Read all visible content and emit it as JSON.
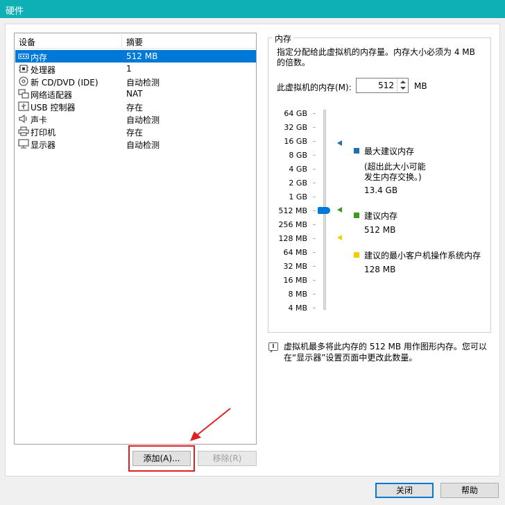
{
  "window": {
    "title": "硬件"
  },
  "device_list": {
    "headers": {
      "device": "设备",
      "summary": "摘要"
    },
    "items": [
      {
        "name": "内存",
        "summary": "512 MB",
        "icon": "memory-icon",
        "selected": true
      },
      {
        "name": "处理器",
        "summary": "1",
        "icon": "processor-icon",
        "selected": false
      },
      {
        "name": "新 CD/DVD (IDE)",
        "summary": "自动检测",
        "icon": "cd-dvd-icon",
        "selected": false
      },
      {
        "name": "网络适配器",
        "summary": "NAT",
        "icon": "network-adapter-icon",
        "selected": false
      },
      {
        "name": "USB 控制器",
        "summary": "存在",
        "icon": "usb-icon",
        "selected": false
      },
      {
        "name": "声卡",
        "summary": "自动检测",
        "icon": "sound-icon",
        "selected": false
      },
      {
        "name": "打印机",
        "summary": "存在",
        "icon": "printer-icon",
        "selected": false
      },
      {
        "name": "显示器",
        "summary": "自动检测",
        "icon": "display-icon",
        "selected": false
      }
    ],
    "add_label": "添加(A)...",
    "remove_label": "移除(R)"
  },
  "memory": {
    "group_label": "内存",
    "description": "指定分配给此虚拟机的内存量。内存大小必须为 4 MB 的倍数。",
    "field_label": "此虚拟机的内存(M):",
    "value": "512",
    "unit": "MB",
    "scale_ticks": [
      "64 GB",
      "32 GB",
      "16 GB",
      "8 GB",
      "4 GB",
      "2 GB",
      "1 GB",
      "512 MB",
      "256 MB",
      "128 MB",
      "64 MB",
      "32 MB",
      "16 MB",
      "8 MB",
      "4 MB"
    ],
    "slider_value": "512 MB",
    "legend": {
      "max": {
        "title": "最大建议内存",
        "note_line1": "(超出此大小可能",
        "note_line2": "发生内存交换。)",
        "value": "13.4 GB",
        "color": "#1f6fb2"
      },
      "recommended": {
        "title": "建议内存",
        "value": "512 MB",
        "color": "#3d9a1f"
      },
      "min_guest": {
        "title": "建议的最小客户机操作系统内存",
        "value": "128 MB",
        "color": "#f0d000"
      }
    },
    "info_line1": "虚拟机最多将此内存的 512 MB 用作图形内存。您可以",
    "info_line2": "在“显示器”设置页面中更改此数量。"
  },
  "footer": {
    "close_label": "关闭",
    "help_label": "帮助"
  },
  "colors": {
    "titlebar": "#0fb0b5",
    "selection": "#0078d7",
    "annotation": "#e02020"
  }
}
